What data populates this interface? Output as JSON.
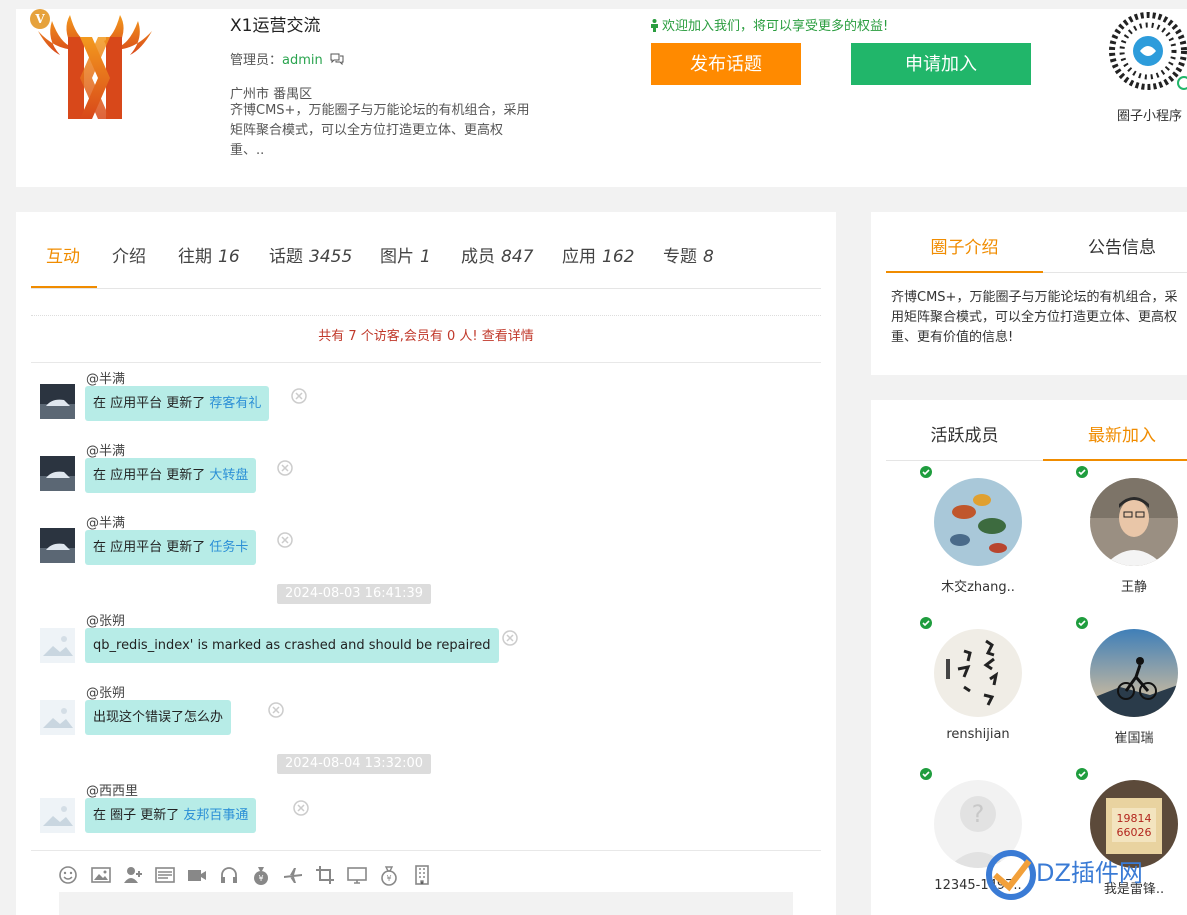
{
  "header": {
    "vip_badge": "V",
    "group_title": "X1运营交流",
    "admin_label": "管理员：",
    "admin_name": "admin",
    "location": "广州市 番禺区",
    "description": "齐博CMS+，万能圈子与万能论坛的有机组合，采用矩阵聚合模式，可以全方位打造更立体、更高权重、..",
    "welcome": "欢迎加入我们，将可以享受更多的权益!",
    "post_button": "发布话题",
    "join_button": "申请加入",
    "qr_label": "圈子小程序"
  },
  "tabs": [
    {
      "label": "互动",
      "count": ""
    },
    {
      "label": "介绍",
      "count": ""
    },
    {
      "label": "往期",
      "count": "16"
    },
    {
      "label": "话题",
      "count": "3455"
    },
    {
      "label": "图片",
      "count": "1"
    },
    {
      "label": "成员",
      "count": "847"
    },
    {
      "label": "应用",
      "count": "162"
    },
    {
      "label": "专题",
      "count": "8"
    }
  ],
  "visitors": {
    "prefix": "共有 7 个访客,会员有 0 人!",
    "link": "查看详情"
  },
  "feed": [
    {
      "user": "@半满",
      "text": "在 应用平台 更新了 ",
      "link": "荐客有礼"
    },
    {
      "user": "@半满",
      "text": "在 应用平台 更新了 ",
      "link": "大转盘"
    },
    {
      "user": "@半满",
      "text": "在 应用平台 更新了 ",
      "link": "任务卡"
    },
    {
      "timestamp": "2024-08-03 16:41:39"
    },
    {
      "user": "@张朔",
      "text": "qb_redis_index' is marked as crashed and should be repaired",
      "link": ""
    },
    {
      "user": "@张朔",
      "text": "出现这个错误了怎么办",
      "link": ""
    },
    {
      "timestamp": "2024-08-04 13:32:00"
    },
    {
      "user": "@西西里",
      "text": "在 圈子 更新了 ",
      "link": "友邦百事通"
    }
  ],
  "toolbar_icons": [
    "smile-icon",
    "image-icon",
    "add-user-icon",
    "card-icon",
    "video-icon",
    "headphones-icon",
    "money-bag-icon",
    "plane-icon",
    "crop-icon",
    "monitor-icon",
    "coin-bag-icon",
    "building-icon"
  ],
  "intro": {
    "tab_intro": "圈子介绍",
    "tab_notice": "公告信息",
    "text": "齐博CMS+，万能圈子与万能论坛的有机组合，采用矩阵聚合模式，可以全方位打造更立体、更高权重、更有价值的信息!"
  },
  "members": {
    "tab_active": "活跃成员",
    "tab_new": "最新加入",
    "list": [
      {
        "name": "木交zhang.."
      },
      {
        "name": "王静"
      },
      {
        "name": "renshijian"
      },
      {
        "name": "崔国瑞"
      },
      {
        "name": "12345-1497.."
      },
      {
        "name": "我是雷锋.."
      }
    ]
  },
  "watermark": "DZ插件网",
  "colors": {
    "accent": "#f08c00",
    "post_button": "#ff8a00",
    "join_button": "#21b66a",
    "bubble": "#b7ece7",
    "link": "#2b8fd6"
  }
}
